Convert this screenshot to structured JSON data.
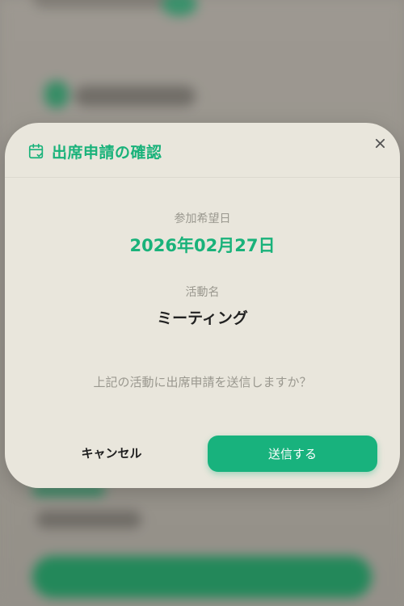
{
  "modal": {
    "title": "出席申請の確認",
    "date_label": "参加希望日",
    "date_value": "2026年02月27日",
    "activity_label": "活動名",
    "activity_value": "ミーティング",
    "question": "上記の活動に出席申請を送信しますか？",
    "cancel_label": "キャンセル",
    "submit_label": "送信する"
  },
  "icons": {
    "header": "calendar-check-icon",
    "close": "close-icon"
  },
  "colors": {
    "accent": "#19b27a",
    "button": "#18b27d",
    "modal_bg": "#e9e6dc",
    "muted_text": "#9a988f"
  }
}
